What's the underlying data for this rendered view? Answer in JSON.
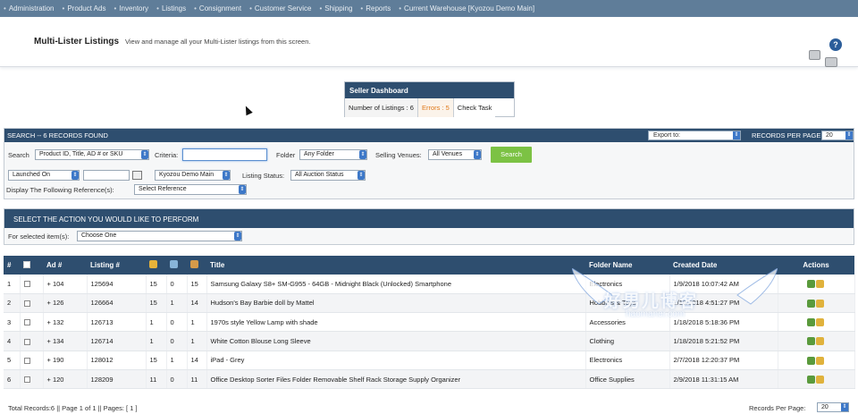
{
  "nav": {
    "items": [
      "Administration",
      "Product Ads",
      "Inventory",
      "Listings",
      "Consignment",
      "Customer Service",
      "Shipping",
      "Reports",
      "Current Warehouse [Kyozou Demo Main]"
    ]
  },
  "header": {
    "title": "Multi-Lister Listings",
    "description": "View and manage all your Multi-Lister listings from this screen."
  },
  "dashboard": {
    "title": "Seller Dashboard",
    "listings": "Number of Listings : 6",
    "errors": "Errors : 5",
    "check_task": "Check Task"
  },
  "search_bar": {
    "title": "SEARCH -- 6 RECORDS FOUND",
    "export_label": "Export to:",
    "records_per_page_label": "RECORDS PER PAGE:",
    "records_per_page_value": "20"
  },
  "search": {
    "search_label": "Search",
    "search_field_value": "Product ID, Title, AD # or SKU",
    "criteria_label": "Criteria:",
    "criteria_value": "",
    "folder_label": "Folder",
    "folder_value": "Any Folder",
    "venues_label": "Selling Venues:",
    "venues_value": "All Venues",
    "search_button": "Search",
    "date_field_value": "Launched On",
    "date_value": "",
    "warehouse_value": "Kyozou Demo Main",
    "listing_status_label": "Listing Status:",
    "listing_status_value": "All Auction Status",
    "reference_label": "Display The Following Reference(s):",
    "reference_value": "Select Reference"
  },
  "action": {
    "title": "SELECT THE ACTION YOU WOULD LIKE TO PERFORM",
    "for_selected_label": "For selected item(s):",
    "choose_value": "Choose One"
  },
  "table": {
    "headers": {
      "num": "#",
      "ad": "Ad #",
      "listing": "Listing #",
      "title": "Title",
      "folder": "Folder Name",
      "created": "Created Date",
      "actions": "Actions"
    },
    "rows": [
      {
        "num": "1",
        "ad": "+ 104",
        "listing": "125694",
        "c1": "15",
        "c2": "0",
        "c3": "15",
        "title": "Samsung Galaxy S8+ SM-G955 - 64GB - Midnight Black (Unlocked) Smartphone",
        "folder": "Electronics",
        "created": "1/9/2018 10:07:42 AM"
      },
      {
        "num": "2",
        "ad": "+ 126",
        "listing": "126664",
        "c1": "15",
        "c2": "1",
        "c3": "14",
        "title": "Hudson's Bay Barbie doll by Mattel",
        "folder": "Hobbies & Toys",
        "created": "1/18/2018 4:51:27 PM"
      },
      {
        "num": "3",
        "ad": "+ 132",
        "listing": "126713",
        "c1": "1",
        "c2": "0",
        "c3": "1",
        "title": "1970s style Yellow Lamp with shade",
        "folder": "Accessories",
        "created": "1/18/2018 5:18:36 PM"
      },
      {
        "num": "4",
        "ad": "+ 134",
        "listing": "126714",
        "c1": "1",
        "c2": "0",
        "c3": "1",
        "title": "White Cotton Blouse Long Sleeve",
        "folder": "Clothing",
        "created": "1/18/2018 5:21:52 PM"
      },
      {
        "num": "5",
        "ad": "+ 190",
        "listing": "128012",
        "c1": "15",
        "c2": "1",
        "c3": "14",
        "title": "iPad - Grey",
        "folder": "Electronics",
        "created": "2/7/2018 12:20:37 PM"
      },
      {
        "num": "6",
        "ad": "+ 120",
        "listing": "128209",
        "c1": "11",
        "c2": "0",
        "c3": "11",
        "title": "Office Desktop Sorter Files Folder Removable Shelf Rack Storage Supply Organizer",
        "folder": "Office Supplies",
        "created": "2/9/2018 11:31:15 AM"
      }
    ]
  },
  "footer": {
    "summary": "Total Records:6 || Page 1 of 1 || Pages: [ 1 ]",
    "rpp_label": "Records Per Page:",
    "rpp_value": "20"
  },
  "watermark": {
    "cn": "好男儿博客",
    "en": "haomaner.com"
  },
  "colors": {
    "nav_bg": "#5f7d99",
    "bar_bg": "#2e4e6f",
    "search_button": "#7cc244",
    "errors": "#e07a1b"
  }
}
